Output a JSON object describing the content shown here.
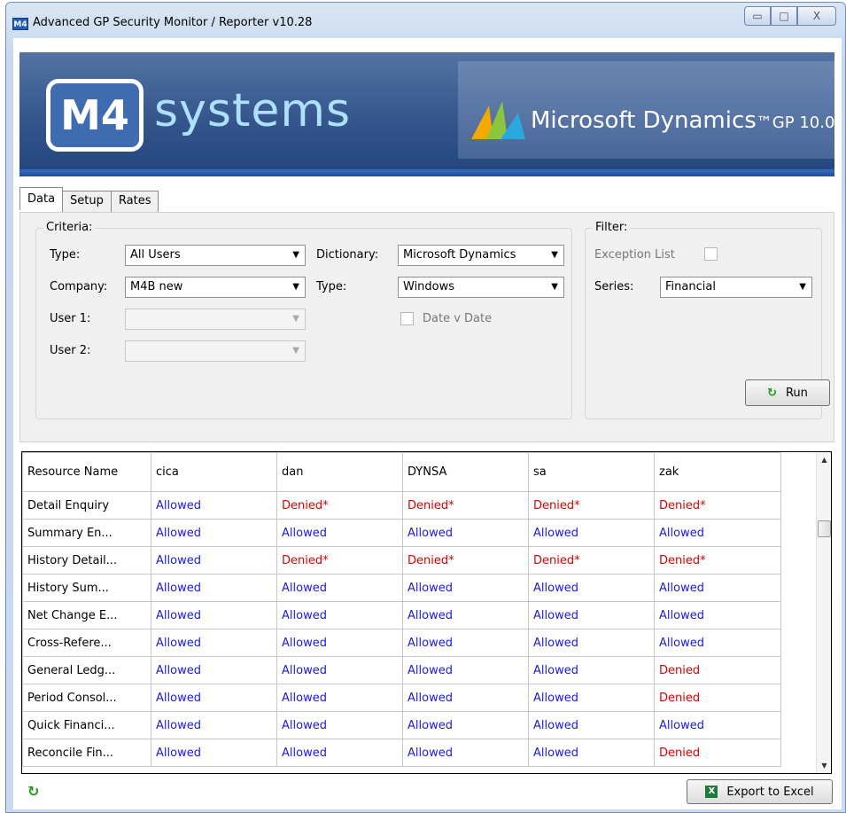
{
  "window": {
    "icon_text": "M4",
    "title": "Advanced GP Security Monitor / Reporter    v10.28",
    "controls": {
      "minimize": "▭",
      "maximize": "□",
      "close": "X"
    }
  },
  "banner": {
    "logo_mark": "M4",
    "logo_word": "systems",
    "ms_text": "Microsoft Dynamics",
    "ms_suffix": "™GP 10.0"
  },
  "tabs": [
    "Data",
    "Setup",
    "Rates"
  ],
  "criteria": {
    "title": "Criteria:",
    "type_label": "Type:",
    "type_value": "All Users",
    "company_label": "Company:",
    "company_value": "M4B new",
    "user1_label": "User 1:",
    "user2_label": "User 2:",
    "dictionary_label": "Dictionary:",
    "dictionary_value": "Microsoft Dynamics",
    "type2_label": "Type:",
    "type2_value": "Windows",
    "date_label": "Date v Date"
  },
  "filter": {
    "title": "Filter:",
    "exception_label": "Exception List",
    "series_label": "Series:",
    "series_value": "Financial",
    "run_label": "Run"
  },
  "grid": {
    "columns": [
      "Resource Name",
      "cica",
      "dan",
      "DYNSA",
      "sa",
      "zak"
    ],
    "rows": [
      [
        "Detail Enquiry",
        "Allowed",
        "Denied*",
        "Denied*",
        "Denied*",
        "Denied*"
      ],
      [
        "Summary En...",
        "Allowed",
        "Allowed",
        "Allowed",
        "Allowed",
        "Allowed"
      ],
      [
        "History Detail...",
        "Allowed",
        "Denied*",
        "Denied*",
        "Denied*",
        "Denied*"
      ],
      [
        "History Sum...",
        "Allowed",
        "Allowed",
        "Allowed",
        "Allowed",
        "Allowed"
      ],
      [
        "Net Change E...",
        "Allowed",
        "Allowed",
        "Allowed",
        "Allowed",
        "Allowed"
      ],
      [
        "Cross-Refere...",
        "Allowed",
        "Allowed",
        "Allowed",
        "Allowed",
        "Allowed"
      ],
      [
        "General Ledg...",
        "Allowed",
        "Allowed",
        "Allowed",
        "Allowed",
        "Denied"
      ],
      [
        "Period Consol...",
        "Allowed",
        "Allowed",
        "Allowed",
        "Allowed",
        "Denied"
      ],
      [
        "Quick Financi...",
        "Allowed",
        "Allowed",
        "Allowed",
        "Allowed",
        "Allowed"
      ],
      [
        "Reconcile Fin...",
        "Allowed",
        "Allowed",
        "Allowed",
        "Allowed",
        "Denied"
      ]
    ],
    "colors": {
      "allowed": "#1a1ae6",
      "denied": "#e00000"
    }
  },
  "footer": {
    "export_label": "Export to Excel"
  }
}
